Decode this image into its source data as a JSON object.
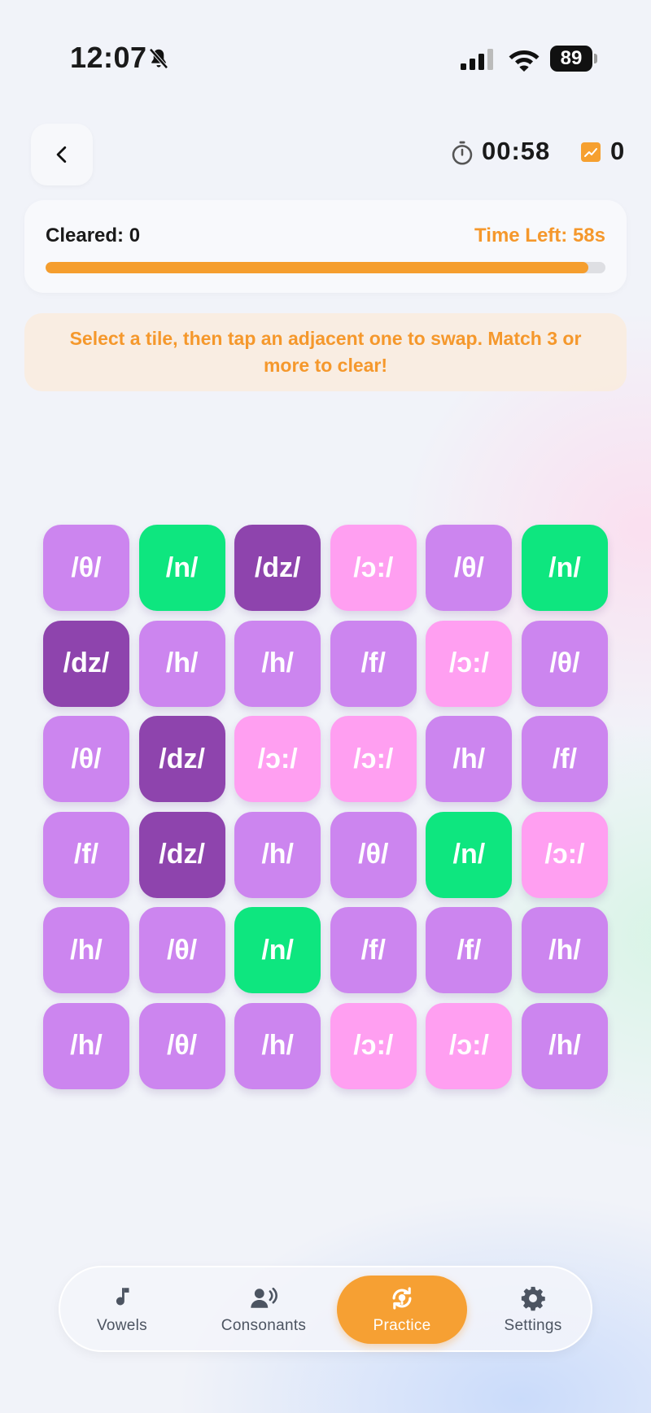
{
  "status_bar": {
    "time": "12:07",
    "battery": "89"
  },
  "header": {
    "timer": "00:58",
    "score": "0"
  },
  "progress": {
    "cleared_label": "Cleared: 0",
    "time_left_label": "Time Left: 58s",
    "fraction": 0.97
  },
  "hint": {
    "text": "Select a tile, then tap an adjacent one to swap. Match 3 or more to clear!"
  },
  "colors": {
    "accent": "#f59e2e",
    "theta": "#cc85ef",
    "h": "#cc85ef",
    "f": "#cc85ef",
    "n": "#0ee67f",
    "dz": "#8e44ad",
    "aw": "#ff9ff1"
  },
  "grid": {
    "rows": [
      [
        "/θ/",
        "/n/",
        "/dz/",
        "/ɔ:/",
        "/θ/",
        "/n/"
      ],
      [
        "/dz/",
        "/h/",
        "/h/",
        "/f/",
        "/ɔ:/",
        "/θ/"
      ],
      [
        "/θ/",
        "/dz/",
        "/ɔ:/",
        "/ɔ:/",
        "/h/",
        "/f/"
      ],
      [
        "/f/",
        "/dz/",
        "/h/",
        "/θ/",
        "/n/",
        "/ɔ:/"
      ],
      [
        "/h/",
        "/θ/",
        "/n/",
        "/f/",
        "/f/",
        "/h/"
      ],
      [
        "/h/",
        "/θ/",
        "/h/",
        "/ɔ:/",
        "/ɔ:/",
        "/h/"
      ]
    ]
  },
  "tabs": [
    {
      "label": "Vowels",
      "icon": "music-note-icon",
      "active": false
    },
    {
      "label": "Consonants",
      "icon": "speaking-person-icon",
      "active": false
    },
    {
      "label": "Practice",
      "icon": "practice-refresh-icon",
      "active": true
    },
    {
      "label": "Settings",
      "icon": "gear-icon",
      "active": false
    }
  ]
}
